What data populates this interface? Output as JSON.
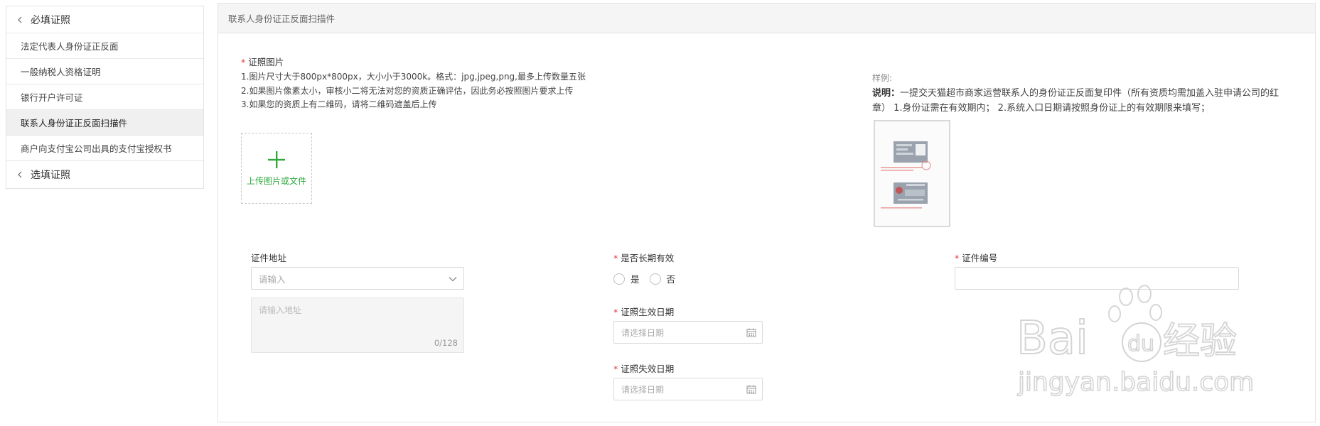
{
  "sidebar": {
    "required_group": "必填证照",
    "items": [
      {
        "label": "法定代表人身份证正反面"
      },
      {
        "label": "一般纳税人资格证明"
      },
      {
        "label": "银行开户许可证"
      },
      {
        "label": "联系人身份证正反面扫描件"
      },
      {
        "label": "商户向支付宝公司出具的支付宝授权书"
      }
    ],
    "active_index": 3,
    "optional_group": "选填证照"
  },
  "panel": {
    "title": "联系人身份证正反面扫描件"
  },
  "photo": {
    "required_mark": "*",
    "label": "证照图片",
    "rules": [
      "1.图片尺寸大于800px*800px，大小小于3000k。格式：jpg,jpeg,png,最多上传数量五张",
      "2.如果图片像素太小，审核小二将无法对您的资质正确评估，因此务必按照图片要求上传",
      "3.如果您的资质上有二维码，请将二维码遮盖后上传"
    ],
    "upload_label": "上传图片或文件"
  },
  "sample": {
    "label": "样例:",
    "desc_bold": "说明：",
    "desc_text": "一提交天猫超市商家运营联系人的身份证正反面复印件（所有资质均需加盖入驻申请公司的红章） 1.身份证需在有效期内； 2.系统入口日期请按照身份证上的有效期限来填写；"
  },
  "form": {
    "address": {
      "label": "证件地址",
      "select_placeholder": "请输入",
      "textarea_placeholder": "请输入地址",
      "counter": "0/128"
    },
    "long_term": {
      "required_mark": "*",
      "label": "是否长期有效",
      "options": [
        "是",
        "否"
      ]
    },
    "start_date": {
      "required_mark": "*",
      "label": "证照生效日期",
      "placeholder": "请选择日期"
    },
    "end_date": {
      "required_mark": "*",
      "label": "证照失效日期",
      "placeholder": "请选择日期"
    },
    "cert_no": {
      "required_mark": "*",
      "label": "证件编号",
      "value": ""
    }
  },
  "watermark": {
    "brand": "Bai",
    "brand_mid": "du",
    "brand_cn": "经验",
    "url": "jingyan.baidu.com"
  },
  "colors": {
    "required": "#e4393c",
    "upload_accent": "#2eaa3c",
    "active_item_bg": "#f0f0f0",
    "border": "#d9d9d9"
  },
  "icons": {
    "group_chevron": "chevron-left-icon",
    "upload": "plus-icon",
    "select": "chevron-down-icon",
    "date": "calendar-icon"
  }
}
